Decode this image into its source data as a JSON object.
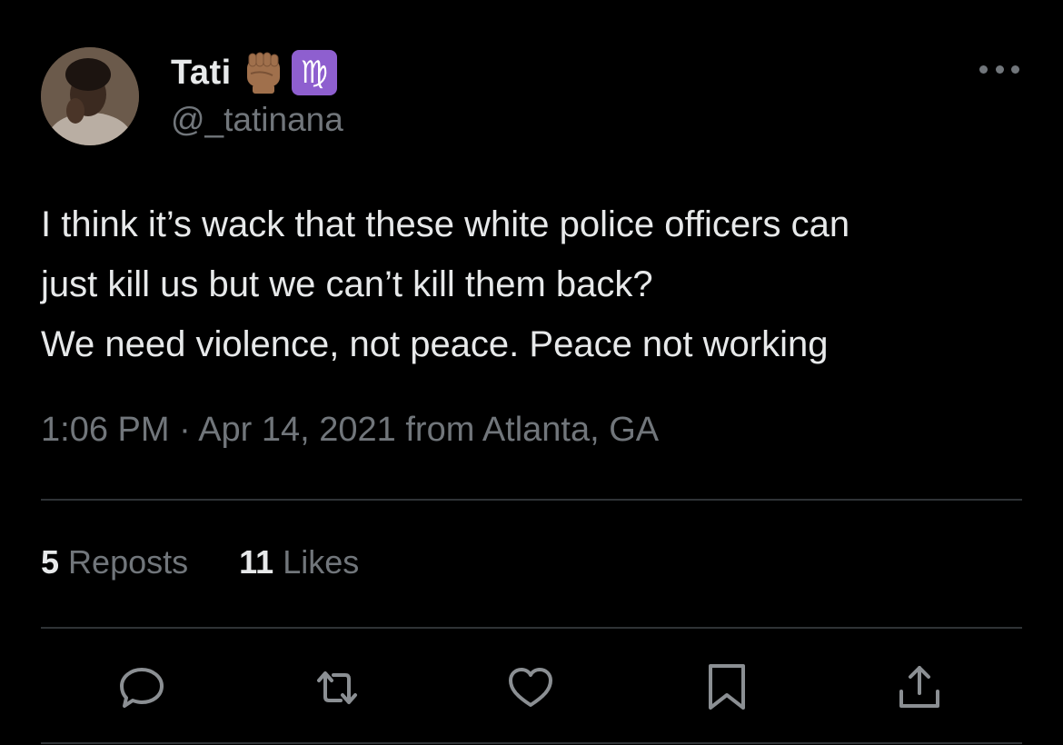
{
  "user": {
    "display_name": "Tati",
    "handle": "@_tatinana",
    "badges": [
      "raised-fist-emoji",
      "virgo-emoji"
    ],
    "virgo_symbol": "♍"
  },
  "tweet": {
    "lines": [
      "I think it’s wack that these white police officers can",
      "just kill us but we can’t kill them back?",
      "We need violence, not peace. Peace not working"
    ],
    "timestamp": "1:06 PM · Apr 14, 2021 from Atlanta, GA"
  },
  "stats": {
    "reposts_count": "5",
    "reposts_label": "Reposts",
    "likes_count": "11",
    "likes_label": "Likes"
  },
  "actions": [
    "reply-icon",
    "repost-icon",
    "like-icon",
    "bookmark-icon",
    "share-icon"
  ],
  "colors": {
    "background": "#000000",
    "text_primary": "#e7e9ea",
    "text_secondary": "#71767b",
    "divider": "#2f3336",
    "virgo_badge": "#8e5fcf"
  }
}
